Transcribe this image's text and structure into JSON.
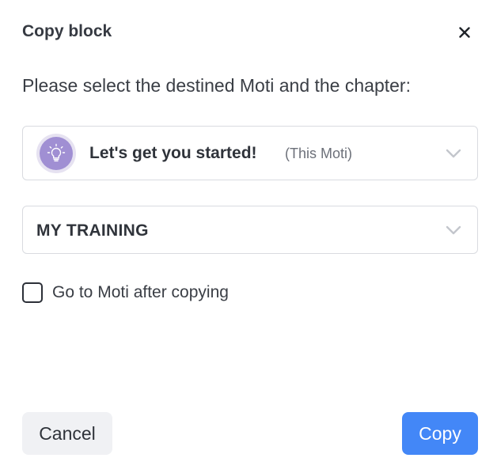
{
  "dialog": {
    "title": "Copy block",
    "close_icon": "close-icon",
    "instruction": "Please select the destined Moti and the chapter:"
  },
  "moti_select": {
    "name": "Let's get you started!",
    "tag": "(This Moti)",
    "avatar_icon": "lightbulb-icon",
    "avatar_color": "#a08fd3"
  },
  "chapter_select": {
    "value": "MY TRAINING"
  },
  "go_to_moti": {
    "label": "Go to Moti after copying",
    "checked": false
  },
  "actions": {
    "cancel_label": "Cancel",
    "copy_label": "Copy",
    "copy_color": "#4387f7"
  }
}
